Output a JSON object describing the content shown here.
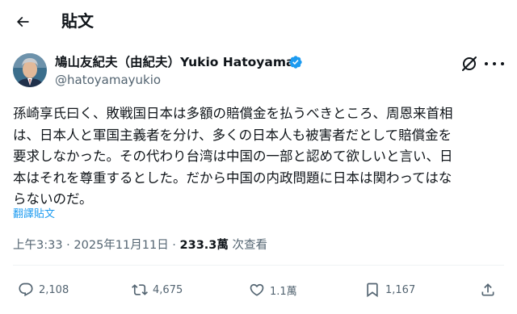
{
  "header": {
    "title": "貼文"
  },
  "author": {
    "display_name": "鳩山友紀夫（由紀夫）Yukio Hatoyama",
    "handle": "@hatoyamayukio",
    "verified": true
  },
  "tweet": {
    "lines": [
      "孫崎享氏曰く、敗戦国日本は多額の賠償金を払うべきところ、周恩来首相",
      "は、日本人と軍国主義者を分け、多くの日本人も被害者だとして賠償金を",
      "要求しなかった。その代わり台湾は中国の一部と認めて欲しいと言い、日",
      "本はそれを尊重するとした。だから中国の内政問題に日本は関わってはな",
      "らないのだ。"
    ],
    "translate_label": "翻譯貼文"
  },
  "meta": {
    "time": "上午3:33",
    "sep1": " · ",
    "date": "2025年11月11日",
    "sep2": " · ",
    "views": "233.3萬",
    "views_label": " 次查看"
  },
  "actions": {
    "replies": "2,108",
    "reposts": "4,675",
    "likes": "1.1萬",
    "bookmarks": "1,167"
  },
  "colors": {
    "accent": "#1d9bf0",
    "secondary_text": "#536471",
    "primary_text": "#0f1419"
  },
  "icons": [
    "back-arrow-icon",
    "verified-badge-icon",
    "grok-icon",
    "more-icon",
    "reply-icon",
    "repost-icon",
    "like-icon",
    "bookmark-icon",
    "share-icon"
  ]
}
